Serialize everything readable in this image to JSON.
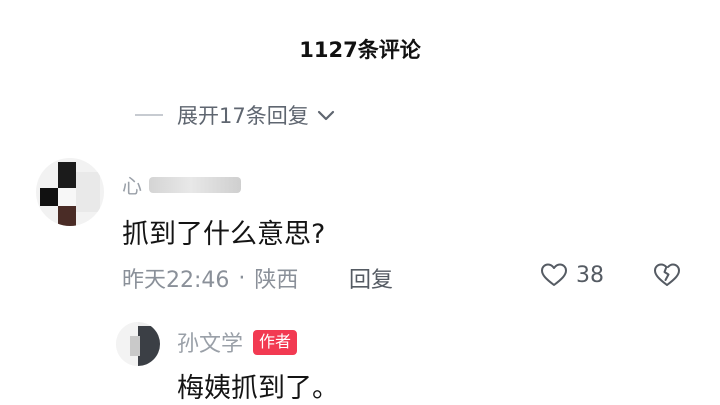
{
  "header": {
    "title": "1127条评论"
  },
  "expand": {
    "label": "展开17条回复",
    "icon": "chevron-down-icon"
  },
  "comment": {
    "username_partial": "心",
    "text": "抓到了什么意思?",
    "time": "昨天22:46",
    "separator": "·",
    "location": "陕西",
    "reply_label": "回复",
    "likes": "38",
    "like_icon": "heart-outline-icon",
    "dislike_icon": "broken-heart-icon"
  },
  "reply": {
    "username": "孙文学",
    "badge": "作者",
    "badge_color": "#f23a52",
    "text": "梅姨抓到了。"
  }
}
